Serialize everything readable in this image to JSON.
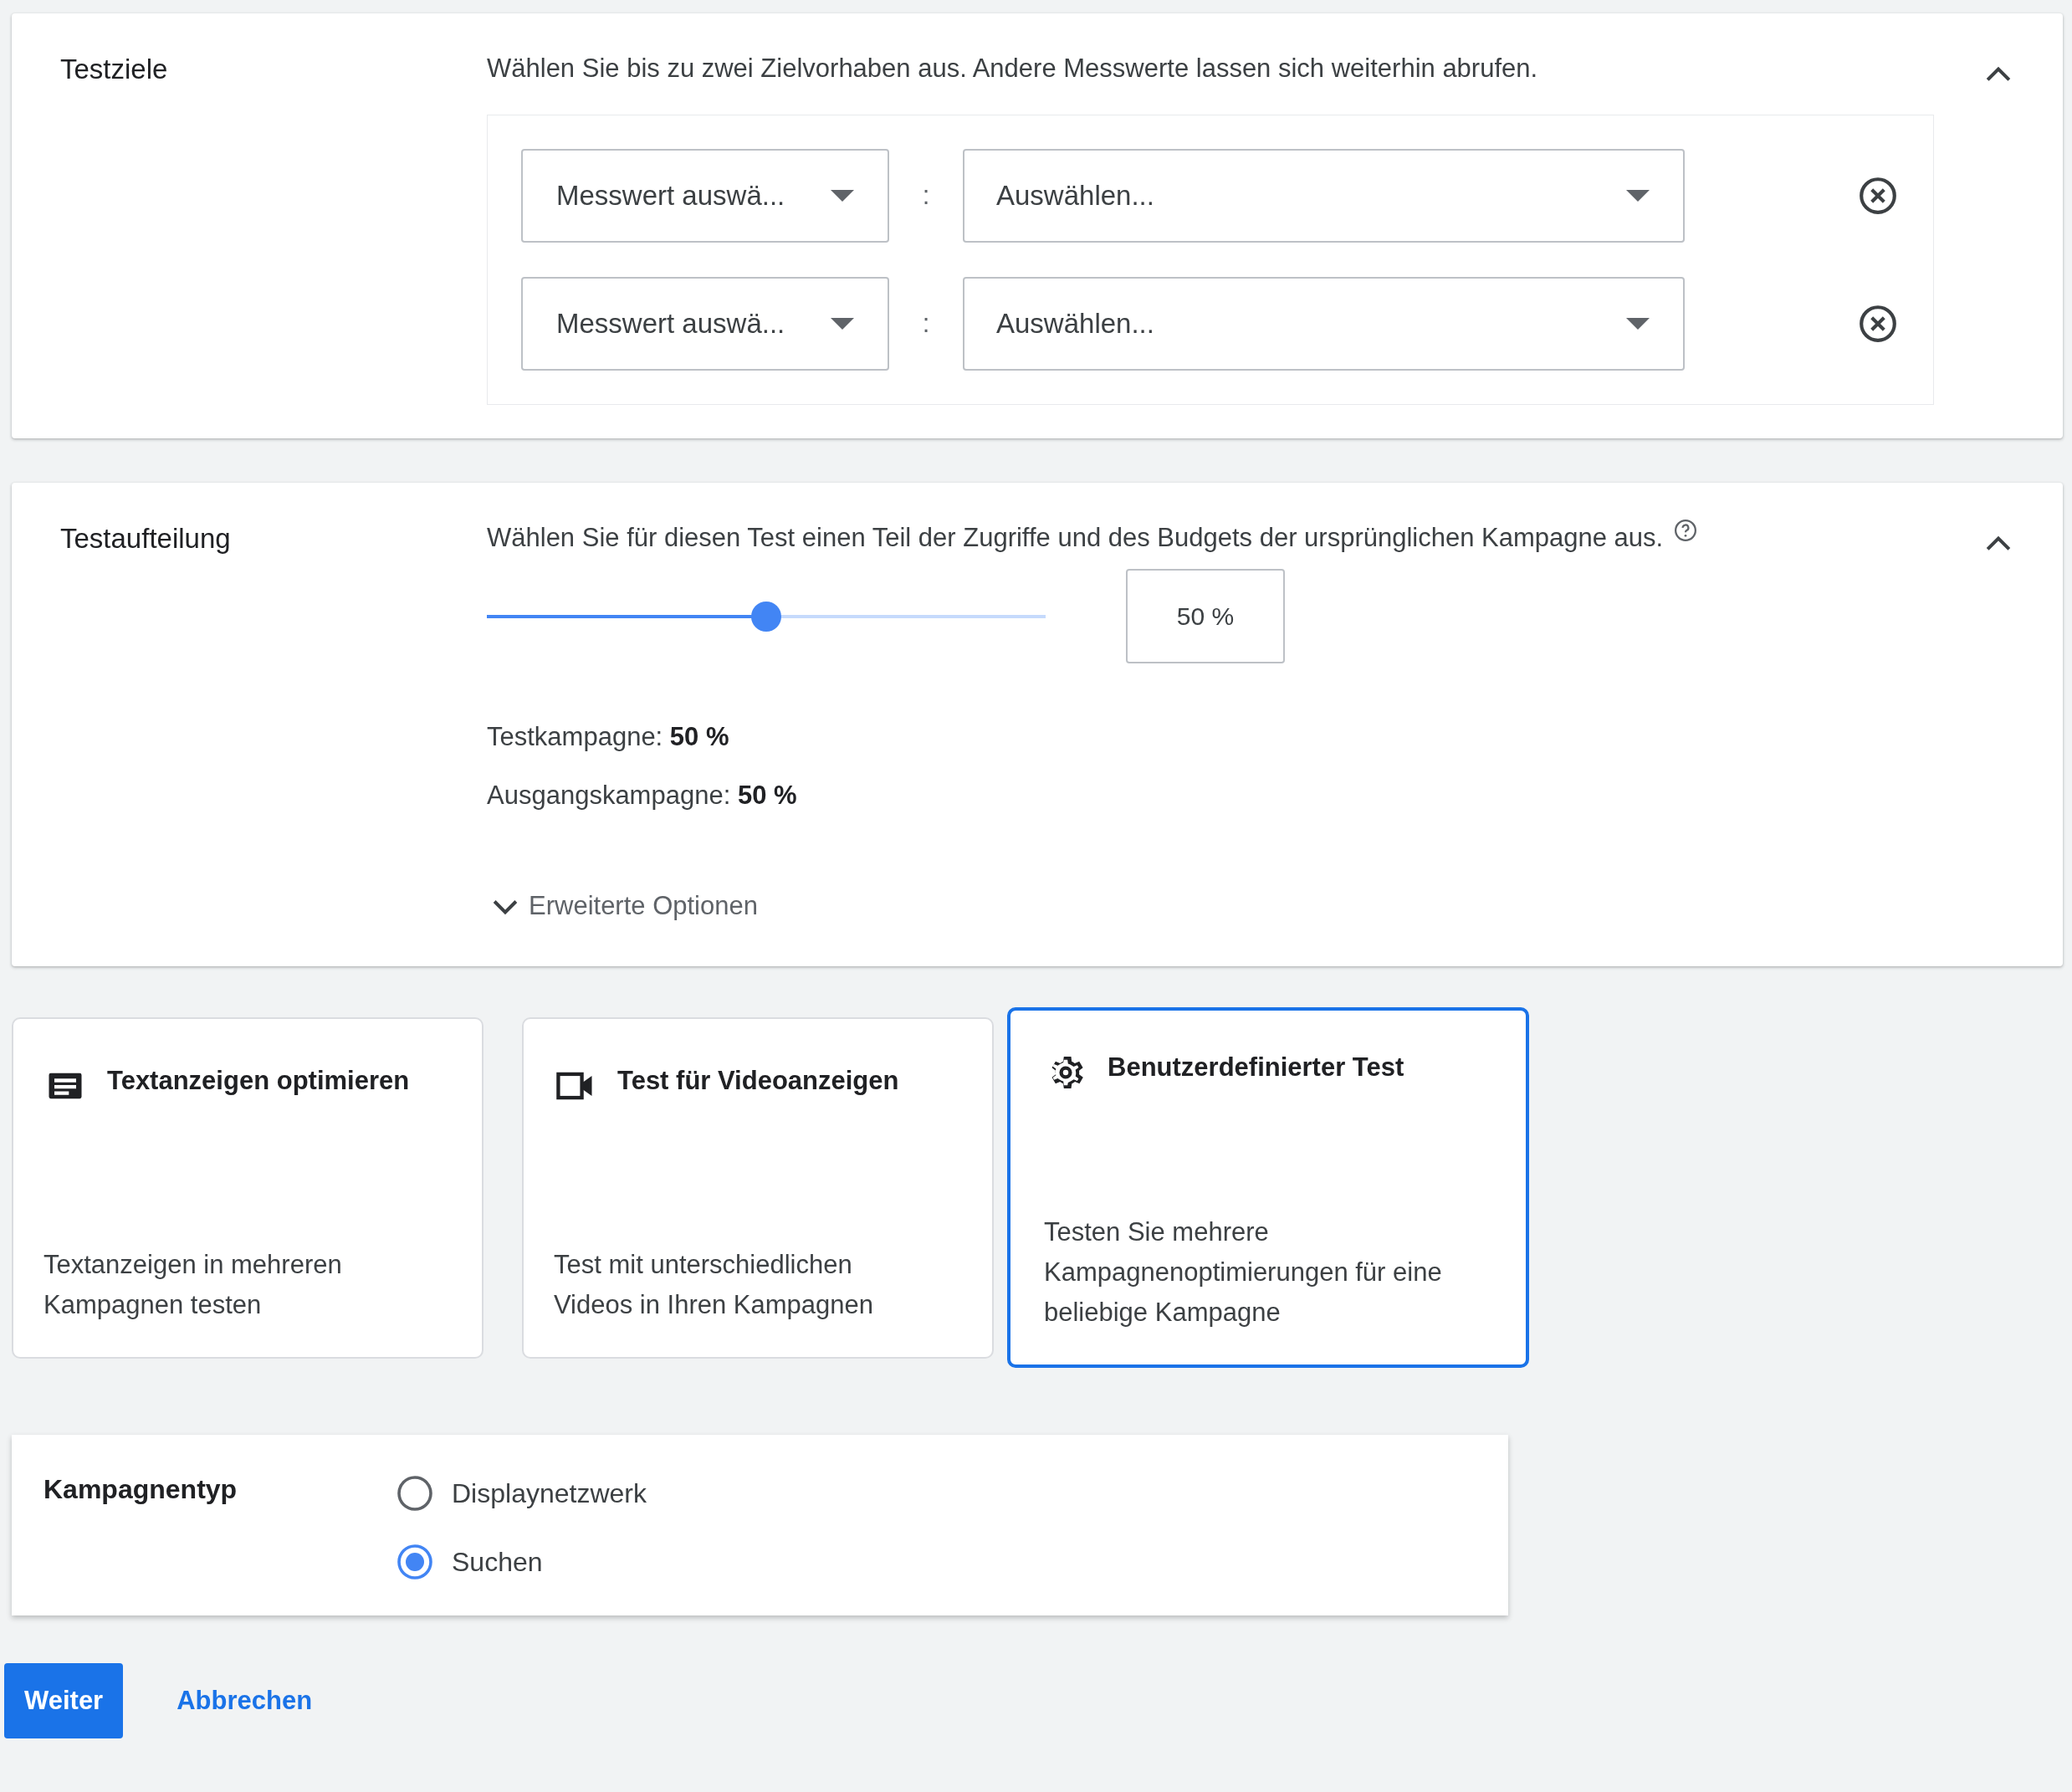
{
  "goals": {
    "title": "Testziele",
    "description": "Wählen Sie bis zu zwei Zielvorhaben aus. Andere Messwerte lassen sich weiterhin abrufen.",
    "expanded": true,
    "rows": [
      {
        "metric": "Messwert auswä...",
        "separator": ":",
        "target": "Auswählen..."
      },
      {
        "metric": "Messwert auswä...",
        "separator": ":",
        "target": "Auswählen..."
      }
    ]
  },
  "split": {
    "title": "Testaufteilung",
    "description": "Wählen Sie für diesen Test einen Teil der Zugriffe und des Budgets der ursprünglichen Kampagne aus.",
    "expanded": true,
    "slider": {
      "level": 0.5
    },
    "percent_field": {
      "value": "50 %"
    },
    "results": [
      {
        "label": "Testkampagne:",
        "value": "50 %"
      },
      {
        "label": "Ausgangskampagne:",
        "value": "50 %"
      }
    ],
    "advanced": {
      "label": "Erweiterte Optionen",
      "expanded": false
    }
  },
  "test_types": [
    {
      "kind": "text",
      "title": "Textanzeigen optimieren",
      "description": "Textanzeigen in mehreren Kampagnen testen",
      "selected": false
    },
    {
      "kind": "video",
      "title": "Test für Videoanzeigen",
      "description": "Test mit unterschiedlichen Videos in Ihren Kampagnen",
      "selected": false
    },
    {
      "kind": "custom",
      "title": "Benutzerdefinierter Test",
      "description": "Testen Sie mehrere Kampagnenoptimierungen für eine beliebige Kampagne",
      "selected": true
    }
  ],
  "campaign_type": {
    "label": "Kampagnentyp",
    "options": [
      {
        "label": "Displaynetzwerk",
        "selected": false
      },
      {
        "label": "Suchen",
        "selected": true
      }
    ]
  },
  "buttons": [
    {
      "kind": "primary",
      "label": "Weiter"
    },
    {
      "kind": "text",
      "label": "Abbrechen"
    }
  ]
}
